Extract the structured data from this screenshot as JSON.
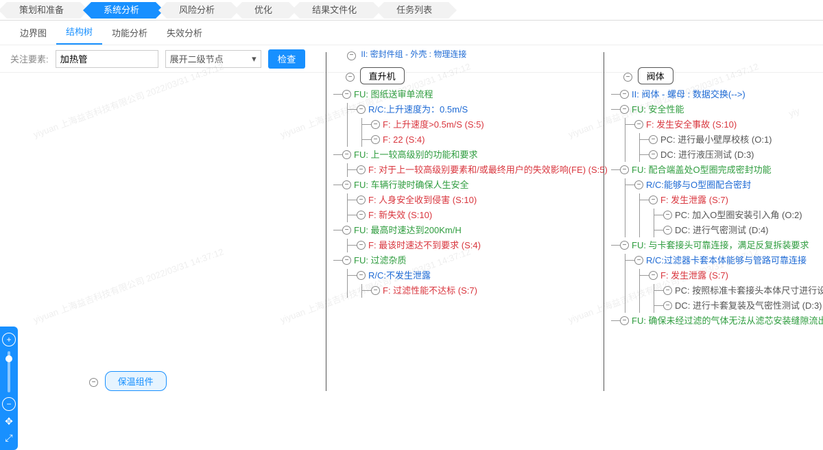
{
  "workflow": [
    "策划和准备",
    "系统分析",
    "风险分析",
    "优化",
    "结果文件化",
    "任务列表"
  ],
  "workflow_active": 1,
  "tabs": [
    "边界图",
    "结构树",
    "功能分析",
    "失效分析"
  ],
  "tabs_active": 1,
  "filter": {
    "label": "关注要素:",
    "input_value": "加热管",
    "select_value": "展开二级节点",
    "button": "检查"
  },
  "zoom": {
    "plus": "+",
    "minus": "−",
    "move": "✥",
    "fit": "⤢"
  },
  "root_node": "保温组件",
  "col1": {
    "title": "直升机",
    "truncated": "II:  密封件组 - 外壳 : 物理连接",
    "items": [
      {
        "t": "fu",
        "text": "FU: 图纸送审单流程",
        "children": [
          {
            "t": "rc",
            "text": "R/C:上升速度为：0.5m/S",
            "children": [
              {
                "t": "f",
                "text": "F:  上升速度>0.5m/S (S:5)"
              },
              {
                "t": "f",
                "text": "F:  22 (S:4)"
              }
            ]
          }
        ]
      },
      {
        "t": "fu",
        "text": "FU: 上一较高级别的功能和要求",
        "children": [
          {
            "t": "f",
            "text": "F:  对于上一较高级别要素和/或最终用户的失效影响(FE) (S:5)"
          }
        ]
      },
      {
        "t": "fu",
        "text": "FU: 车辆行驶时确保人生安全",
        "children": [
          {
            "t": "f",
            "text": "F:  人身安全收到侵害 (S:10)"
          },
          {
            "t": "f",
            "text": "F:  新失效 (S:10)"
          }
        ]
      },
      {
        "t": "fu",
        "text": "FU: 最高时速达到200Km/H",
        "children": [
          {
            "t": "f",
            "text": "F:  最该时速达不到要求 (S:4)"
          }
        ]
      },
      {
        "t": "fu",
        "text": "FU: 过滤杂质",
        "children": [
          {
            "t": "rc",
            "text": "R/C:不发生泄露",
            "children": [
              {
                "t": "f",
                "text": "F:  过滤性能不达标 (S:7)"
              }
            ]
          }
        ]
      }
    ]
  },
  "col2": {
    "title": "阀体",
    "items": [
      {
        "t": "ii",
        "text": "II:  阀体 - 螺母 : 数据交换(-->)"
      },
      {
        "t": "fu",
        "text": "FU: 安全性能",
        "children": [
          {
            "t": "f",
            "text": "F:  发生安全事故 (S:10)",
            "children": [
              {
                "t": "pc",
                "text": "PC: 进行最小壁厚校核 (O:1)"
              },
              {
                "t": "dc",
                "text": "DC: 进行液压测试 (D:3)"
              }
            ]
          }
        ]
      },
      {
        "t": "fu",
        "text": "FU: 配合端盖处O型圈完成密封功能",
        "children": [
          {
            "t": "rc",
            "text": "R/C:能够与O型圈配合密封",
            "children": [
              {
                "t": "f",
                "text": "F:  发生泄露 (S:7)",
                "children": [
                  {
                    "t": "pc",
                    "text": "PC: 加入O型圈安装引入角 (O:2)"
                  },
                  {
                    "t": "dc",
                    "text": "DC: 进行气密测试 (D:4)"
                  }
                ]
              }
            ]
          }
        ]
      },
      {
        "t": "fu",
        "text": "FU: 与卡套接头可靠连接，满足反复拆装要求",
        "children": [
          {
            "t": "rc",
            "text": "R/C:过滤器卡套本体能够与管路可靠连接",
            "children": [
              {
                "t": "f",
                "text": "F:  发生泄露 (S:7)",
                "children": [
                  {
                    "t": "pc",
                    "text": "PC: 按照标准卡套接头本体尺寸进行设计 (O:"
                  },
                  {
                    "t": "dc",
                    "text": "DC: 进行卡套复装及气密性测试 (D:3)"
                  }
                ]
              }
            ]
          }
        ]
      },
      {
        "t": "fu",
        "text": "FU: 确保未经过滤的气体无法从滤芯安装缝隙流出"
      }
    ]
  },
  "watermark": "yiyuan 上海益吉科技有限公司 2022/03/31 14:37:12"
}
